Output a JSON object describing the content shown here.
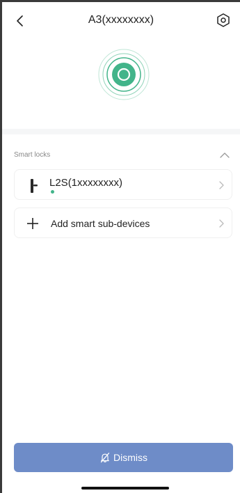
{
  "header": {
    "title": "A3(xxxxxxxx)",
    "back_icon": "chevron-left-icon",
    "settings_icon": "hexagon-settings-icon"
  },
  "hub": {
    "status_icon": "signal-ring-icon",
    "accent_color": "#42b48a"
  },
  "section": {
    "title": "Smart locks",
    "collapse_icon": "chevron-up-icon"
  },
  "devices": [
    {
      "name": "L2S(1xxxxxxxx)",
      "icon": "door-lock-icon",
      "status_color": "#42b48a"
    }
  ],
  "add_device": {
    "label": "Add smart sub-devices",
    "icon": "plus-icon"
  },
  "dismiss": {
    "label": "Dismiss",
    "icon": "bell-off-icon",
    "color": "#6e8cc8"
  }
}
